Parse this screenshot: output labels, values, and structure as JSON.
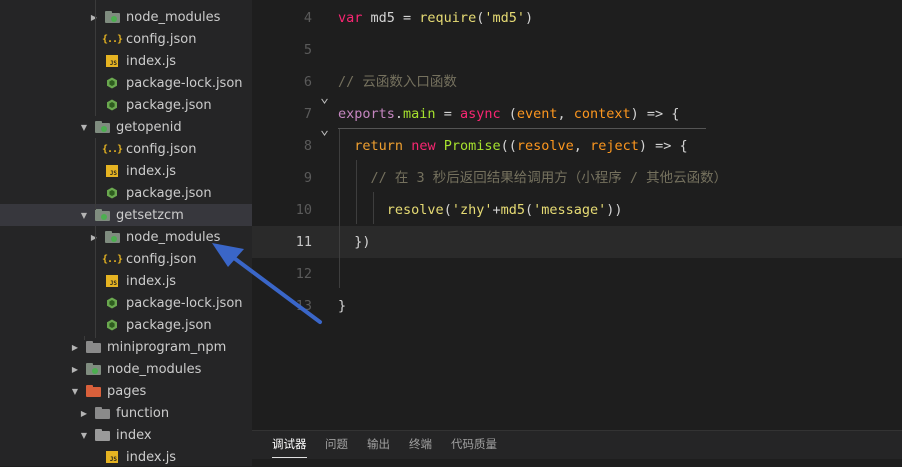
{
  "sidebar": {
    "tree": [
      {
        "label": "node_modules",
        "icon": "folder-node-icon",
        "expanded": false,
        "indent": 2
      },
      {
        "label": "config.json",
        "icon": "json-file-icon",
        "indent": 2
      },
      {
        "label": "index.js",
        "icon": "js-file-icon",
        "indent": 2
      },
      {
        "label": "package-lock.json",
        "icon": "npm-package-icon",
        "indent": 2
      },
      {
        "label": "package.json",
        "icon": "npm-package-icon",
        "indent": 2
      },
      {
        "label": "getopenid",
        "icon": "folder-cloud-icon",
        "expanded": true,
        "indent": 1
      },
      {
        "label": "config.json",
        "icon": "json-file-icon",
        "indent": 2
      },
      {
        "label": "index.js",
        "icon": "js-file-icon",
        "indent": 2
      },
      {
        "label": "package.json",
        "icon": "npm-package-icon",
        "indent": 2
      },
      {
        "label": "getsetzcm",
        "icon": "folder-cloud-icon",
        "expanded": true,
        "indent": 1,
        "selected": true
      },
      {
        "label": "node_modules",
        "icon": "folder-node-icon",
        "expanded": false,
        "indent": 2
      },
      {
        "label": "config.json",
        "icon": "json-file-icon",
        "indent": 2
      },
      {
        "label": "index.js",
        "icon": "js-file-icon",
        "indent": 2
      },
      {
        "label": "package-lock.json",
        "icon": "npm-package-icon",
        "indent": 2
      },
      {
        "label": "package.json",
        "icon": "npm-package-icon",
        "indent": 2
      },
      {
        "label": "miniprogram_npm",
        "icon": "folder-icon",
        "expanded": false,
        "indent": 0
      },
      {
        "label": "node_modules",
        "icon": "folder-node-icon",
        "expanded": false,
        "indent": 0
      },
      {
        "label": "pages",
        "icon": "folder-pages-icon",
        "expanded": true,
        "indent": 0
      },
      {
        "label": "function",
        "icon": "folder-icon",
        "expanded": false,
        "indent": 1
      },
      {
        "label": "index",
        "icon": "folder-open-icon",
        "expanded": true,
        "indent": 1
      },
      {
        "label": "index.js",
        "icon": "js-file-icon",
        "indent": 2
      }
    ]
  },
  "editor": {
    "active_line": "11",
    "lines": [
      {
        "num": "4",
        "tokens": [
          [
            "k",
            "var"
          ],
          [
            "punc",
            " md5 = "
          ],
          [
            "fn",
            "require"
          ],
          [
            "punc",
            "("
          ],
          [
            "str",
            "'md5'"
          ],
          [
            "punc",
            ")"
          ]
        ]
      },
      {
        "num": "5",
        "tokens": []
      },
      {
        "num": "6",
        "tokens": [
          [
            "cmt",
            "// 云函数入口函数"
          ]
        ]
      },
      {
        "num": "7",
        "tokens": [
          [
            "obj",
            "exports"
          ],
          [
            "punc",
            "."
          ],
          [
            "green",
            "main"
          ],
          [
            "punc",
            " = "
          ],
          [
            "k",
            "async"
          ],
          [
            "punc",
            " ("
          ],
          [
            "prm",
            "event"
          ],
          [
            "punc",
            ", "
          ],
          [
            "prm",
            "context"
          ],
          [
            "punc",
            ") => {"
          ]
        ]
      },
      {
        "num": "8",
        "tokens": [
          [
            "punc",
            "  "
          ],
          [
            "kw",
            "return"
          ],
          [
            "punc",
            " "
          ],
          [
            "k",
            "new"
          ],
          [
            "punc",
            " "
          ],
          [
            "green",
            "Promise"
          ],
          [
            "punc",
            "(("
          ],
          [
            "prm",
            "resolve"
          ],
          [
            "punc",
            ", "
          ],
          [
            "prm",
            "reject"
          ],
          [
            "punc",
            ") => {"
          ]
        ]
      },
      {
        "num": "9",
        "tokens": [
          [
            "punc",
            "    "
          ],
          [
            "cmt",
            "// 在 3 秒后返回结果给调用方（小程序 / 其他云函数）"
          ]
        ]
      },
      {
        "num": "10",
        "tokens": [
          [
            "punc",
            "      "
          ],
          [
            "fn",
            "resolve"
          ],
          [
            "punc",
            "("
          ],
          [
            "str",
            "'zhy'"
          ],
          [
            "punc",
            "+"
          ],
          [
            "fn",
            "md5"
          ],
          [
            "punc",
            "("
          ],
          [
            "str",
            "'message'"
          ],
          [
            "punc",
            "))"
          ]
        ]
      },
      {
        "num": "11",
        "tokens": [
          [
            "punc",
            "  })"
          ]
        ]
      },
      {
        "num": "12",
        "tokens": []
      },
      {
        "num": "13",
        "tokens": [
          [
            "punc",
            "}"
          ]
        ]
      }
    ]
  },
  "panel": {
    "tabs": [
      "调试器",
      "问题",
      "输出",
      "终端",
      "代码质量"
    ],
    "active_tab": "调试器"
  },
  "annotation": {
    "color": "#3a66c8"
  }
}
